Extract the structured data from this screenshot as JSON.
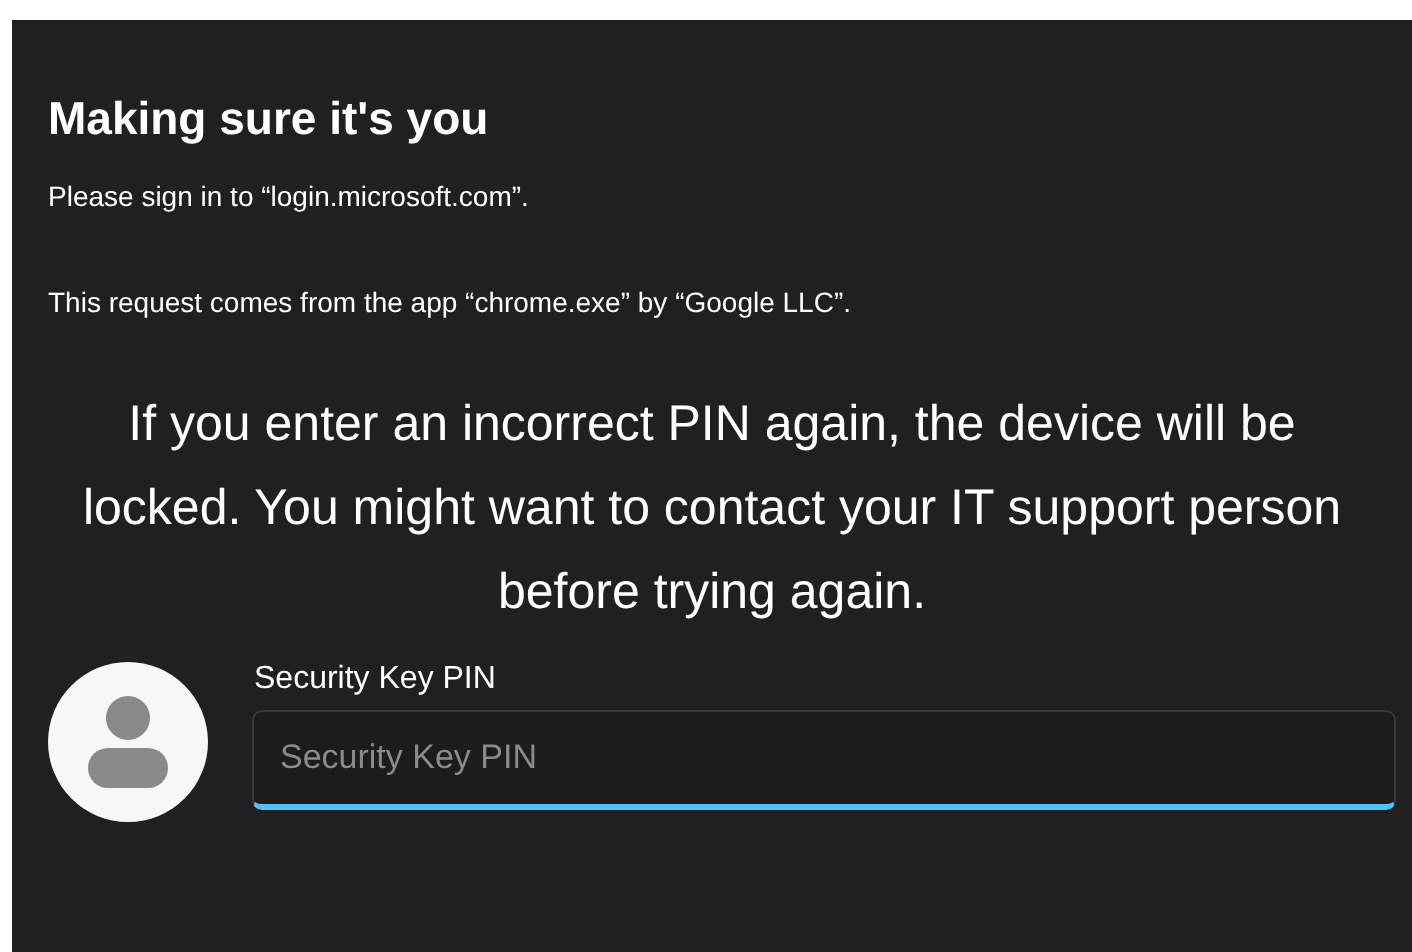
{
  "title": "Making sure it's you",
  "messages": [
    "Please sign in to “login.microsoft.com”.",
    "This request comes from the app “chrome.exe” by “Google LLC”."
  ],
  "warning": "If you enter an incorrect PIN again, the device will be locked. You might want to contact your IT support person before trying again.",
  "pin_field": {
    "label": "Security Key PIN",
    "placeholder": "Security Key PIN"
  }
}
